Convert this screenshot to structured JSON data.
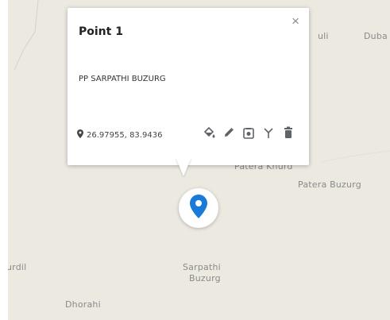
{
  "map": {
    "places": [
      {
        "id": "uli",
        "name": "uli"
      },
      {
        "id": "duba",
        "name": "Duba"
      },
      {
        "id": "patera-khurd",
        "name": "Patera Khurd"
      },
      {
        "id": "patera-buzurg",
        "name": "Patera Buzurg"
      },
      {
        "id": "urdil",
        "name": "urdil"
      },
      {
        "id": "sarpathi-1",
        "name": "Sarpathi"
      },
      {
        "id": "sarpathi-2",
        "name": "Buzurg"
      },
      {
        "id": "dhorahi",
        "name": "Dhorahi"
      }
    ]
  },
  "popup": {
    "title": "Point 1",
    "close_label": "×",
    "description": "PP SARPATHI BUZURG",
    "coordinates": "26.97955, 83.9436",
    "tools": [
      {
        "name": "fill-color-icon"
      },
      {
        "name": "edit-icon"
      },
      {
        "name": "camera-icon"
      },
      {
        "name": "filter-icon"
      },
      {
        "name": "delete-icon"
      }
    ]
  },
  "colors": {
    "map_background": "#ece9e1",
    "marker_blue": "#1a7ad9",
    "icon_gray": "#5f6368"
  }
}
